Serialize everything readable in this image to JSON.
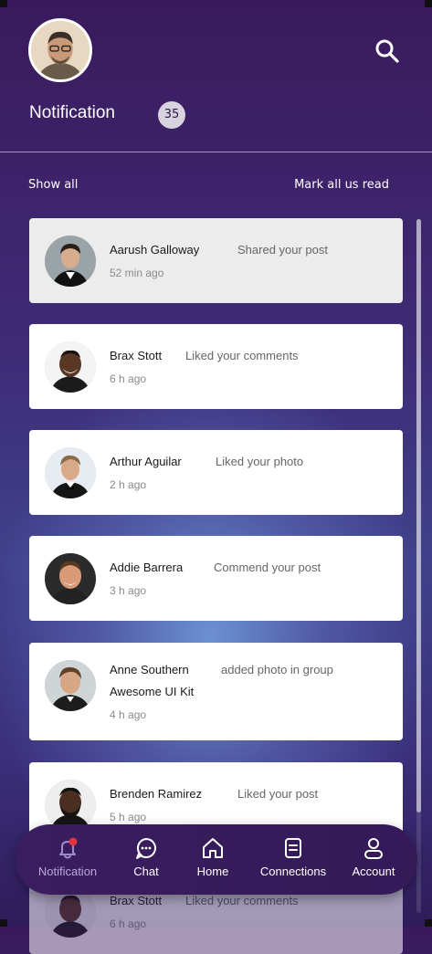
{
  "header": {
    "title": "Notification",
    "badge_count": "35"
  },
  "actions": {
    "show_all": "Show all",
    "mark_all_read": "Mark all us read"
  },
  "notifications": [
    {
      "name": "Aarush Galloway",
      "action": "Shared your post",
      "time": "52 min ago",
      "read": true
    },
    {
      "name": "Brax Stott",
      "action": "Liked your comments",
      "time": "6 h ago",
      "read": false
    },
    {
      "name": "Arthur Aguilar",
      "action": "Liked your photo",
      "time": "2 h ago",
      "read": false
    },
    {
      "name": "Addie Barrera",
      "action": "Commend your post",
      "time": "3 h ago",
      "read": false
    },
    {
      "name": "Anne Southern",
      "action": "added photo in group",
      "action_line2": "Awesome UI Kit",
      "time": "4 h ago",
      "read": false
    },
    {
      "name": "Brenden Ramirez",
      "action": "Liked your post",
      "time": "5 h ago",
      "read": false
    },
    {
      "name": "Brax Stott",
      "action": "Liked your comments",
      "time": "6 h ago",
      "read": false
    }
  ],
  "nav": {
    "items": [
      {
        "label": "Notification",
        "icon": "bell-icon",
        "active": true
      },
      {
        "label": "Chat",
        "icon": "chat-icon",
        "active": false
      },
      {
        "label": "Home",
        "icon": "home-icon",
        "active": false
      },
      {
        "label": "Connections",
        "icon": "connections-icon",
        "active": false
      },
      {
        "label": "Account",
        "icon": "account-icon",
        "active": false
      }
    ]
  },
  "colors": {
    "background_top": "#3a1a5c",
    "background_glow": "#6e96d7",
    "card": "#ffffff",
    "card_read": "#ececec",
    "nav_bg": "#3a1d60",
    "notification_dot": "#e0323c"
  }
}
